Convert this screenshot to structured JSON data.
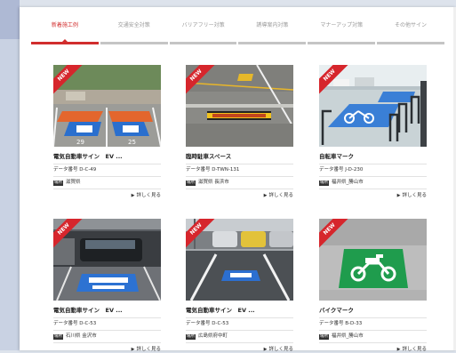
{
  "tabs": [
    {
      "label": "新着施工例",
      "active": true
    },
    {
      "label": "交通安全対策",
      "active": false
    },
    {
      "label": "バリアフリー対策",
      "active": false
    },
    {
      "label": "誘導案内対策",
      "active": false
    },
    {
      "label": "マナーアップ対策",
      "active": false
    },
    {
      "label": "その他サイン",
      "active": false
    }
  ],
  "badge": "NEW",
  "labels": {
    "data_no": "データ番号",
    "location_tag": "場所",
    "more": "詳しく見る"
  },
  "items": [
    {
      "title": "電気自動車サイン　EV ...",
      "data_no": "D-C-49",
      "location": "滋賀県",
      "photo": "ev-parking-outdoor"
    },
    {
      "title": "臨時駐車スペース",
      "data_no": "D-TWN-131",
      "location": "滋賀県 長浜市",
      "photo": "temporary-parking-road"
    },
    {
      "title": "自転車マーク",
      "data_no": "J-D-230",
      "location": "福井県_勝山市",
      "photo": "bicycle-parking"
    },
    {
      "title": "電気自動車サイン　EV ...",
      "data_no": "D-C-53",
      "location": "石川県 金沢市",
      "photo": "ev-quick-charge-garage"
    },
    {
      "title": "電気自動車サイン　EV ...",
      "data_no": "D-C-53",
      "location": "広島県府中町",
      "photo": "ev-parking-garage"
    },
    {
      "title": "バイクマーク",
      "data_no": "B-D-33",
      "location": "福井県_勝山市",
      "photo": "motorcycle-mark"
    }
  ]
}
